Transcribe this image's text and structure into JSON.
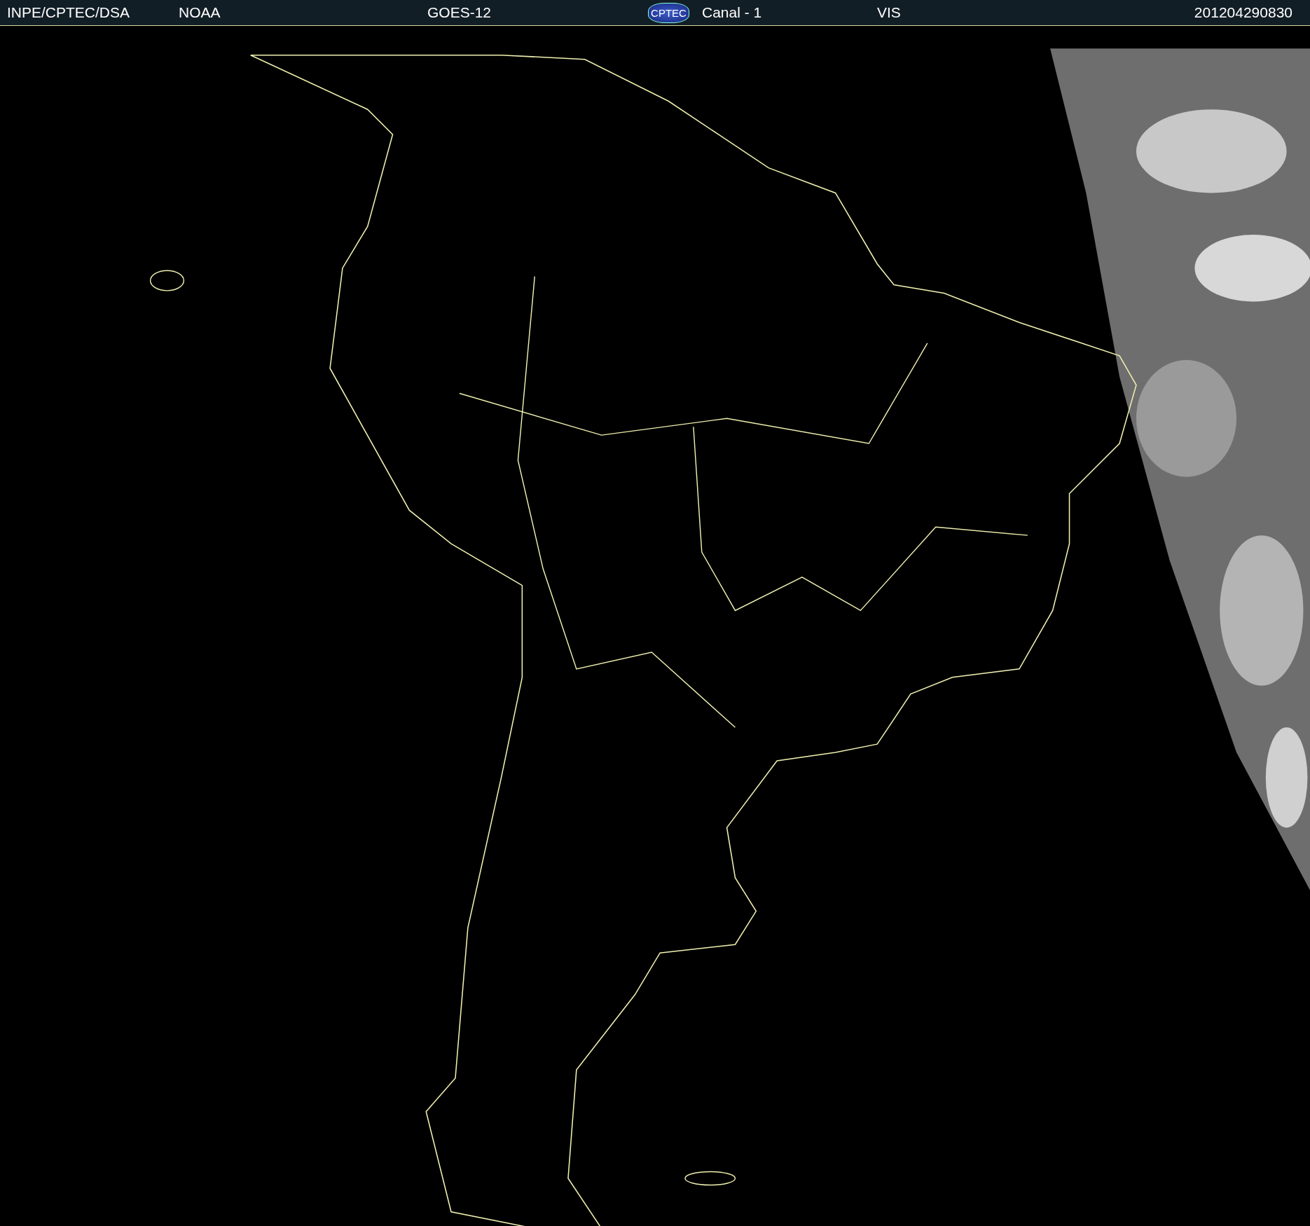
{
  "header": {
    "source": "INPE/CPTEC/DSA",
    "agency": "NOAA",
    "satellite": "GOES-12",
    "logo": "CPTEC",
    "channel": "Canal - 1",
    "band": "VIS",
    "timestamp": "201204290830"
  }
}
